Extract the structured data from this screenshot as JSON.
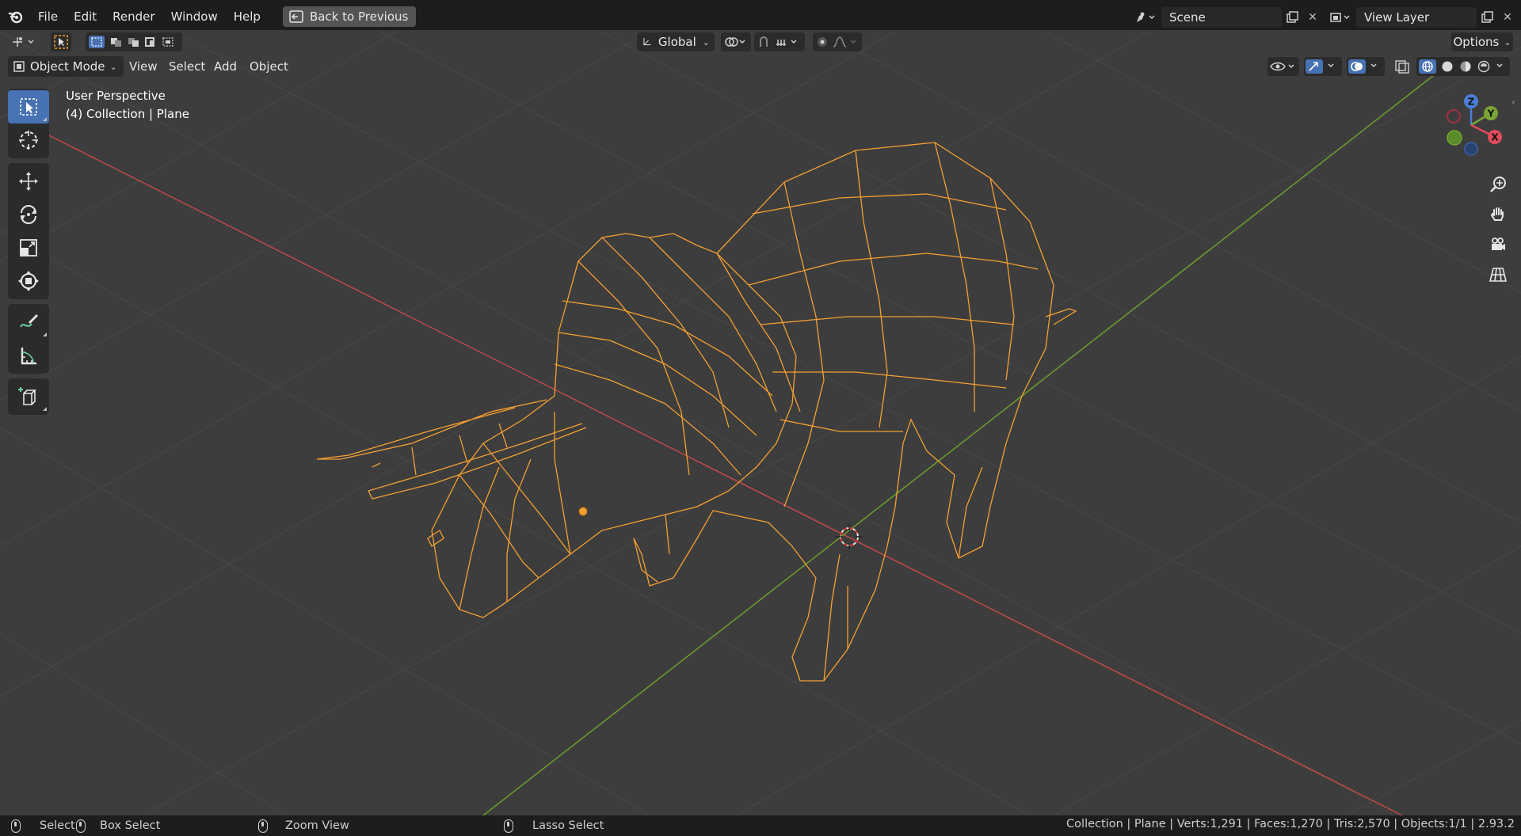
{
  "menu": {
    "items": [
      "File",
      "Edit",
      "Render",
      "Window",
      "Help"
    ],
    "back_button": "Back to Previous"
  },
  "scene": {
    "label": "Scene",
    "view_layer": "View Layer"
  },
  "header": {
    "transform_orientation": "Global",
    "options_label": "Options"
  },
  "viewport_header": {
    "mode": "Object Mode",
    "menus": [
      "View",
      "Select",
      "Add",
      "Object"
    ]
  },
  "overlay": {
    "perspective": "User Perspective",
    "collection": "(4) Collection | Plane"
  },
  "gizmo": {
    "z": "Z",
    "y": "Y",
    "x": "X"
  },
  "toolbar": {
    "tools": [
      "select-box",
      "cursor",
      "move",
      "rotate",
      "scale",
      "transform",
      "annotate",
      "measure",
      "add-cube"
    ],
    "active": "select-box"
  },
  "status": {
    "select": "Select",
    "box_select": "Box Select",
    "zoom_view": "Zoom View",
    "lasso_select": "Lasso Select",
    "stats": "Collection | Plane | Verts:1,291 | Faces:1,270 | Tris:2,570 | Objects:1/1 | 2.93.2"
  },
  "colors": {
    "viewport_bg": "#3d3d3d",
    "wire_selected": "#f5a032",
    "axis_x": "#c84b4b",
    "axis_y": "#6a9a2e",
    "active_tool": "#4772b3"
  }
}
